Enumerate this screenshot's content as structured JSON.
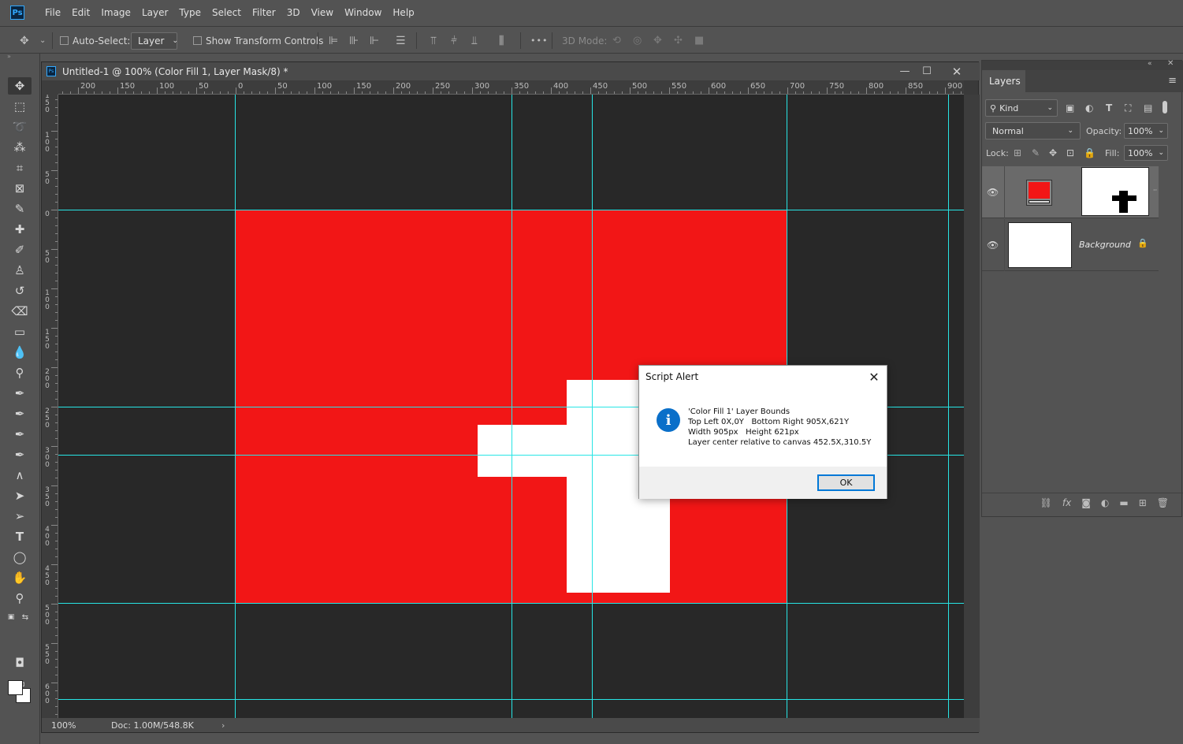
{
  "app": {
    "logo": "Ps"
  },
  "menu": [
    "File",
    "Edit",
    "Image",
    "Layer",
    "Type",
    "Select",
    "Filter",
    "3D",
    "View",
    "Window",
    "Help"
  ],
  "options": {
    "auto_select_label": "Auto-Select:",
    "auto_select_value": "Layer",
    "show_transform_label": "Show Transform Controls",
    "three_d_mode_label": "3D Mode:",
    "more": "•••"
  },
  "document": {
    "title": "Untitled-1 @ 100% (Color Fill 1, Layer Mask/8) *",
    "zoom": "100%",
    "doc_size": "Doc: 1.00M/548.8K",
    "hruler_labels": [
      "200",
      "150",
      "100",
      "50",
      "0",
      "50",
      "100",
      "150",
      "200",
      "250",
      "300",
      "350",
      "400",
      "450",
      "500",
      "550",
      "600",
      "650",
      "700",
      "750",
      "800",
      "850",
      "900"
    ],
    "vruler_labels": [
      "150",
      "100",
      "50",
      "0",
      "50",
      "100",
      "150",
      "200",
      "250",
      "300",
      "350",
      "400",
      "450",
      "500",
      "550",
      "600"
    ]
  },
  "layers_panel": {
    "tab": "Layers",
    "filter_kind": "Kind",
    "blend_mode": "Normal",
    "opacity_label": "Opacity:",
    "opacity_value": "100%",
    "lock_label": "Lock:",
    "fill_label": "Fill:",
    "fill_value": "100%",
    "layers": [
      {
        "name": "",
        "type": "color-fill",
        "fill_color": "#f21616"
      },
      {
        "name": "Background",
        "locked": true
      }
    ],
    "footer_icons": [
      "link-icon",
      "fx-icon",
      "add-mask-icon",
      "adjustment-icon",
      "folder-icon",
      "new-layer-icon",
      "trash-icon"
    ],
    "fx": "fx"
  },
  "dialog": {
    "title": "Script Alert",
    "line1": "'Color Fill 1' Layer Bounds",
    "line2": "Top Left 0X,0Y   Bottom Right 905X,621Y",
    "line3": "Width 905px   Height 621px",
    "line4": "Layer center relative to canvas 452.5X,310.5Y",
    "ok": "OK",
    "icon_glyph": "i"
  },
  "colors": {
    "fill_red": "#f21616",
    "guide": "#27e5e5",
    "accent": "#0078d7"
  }
}
